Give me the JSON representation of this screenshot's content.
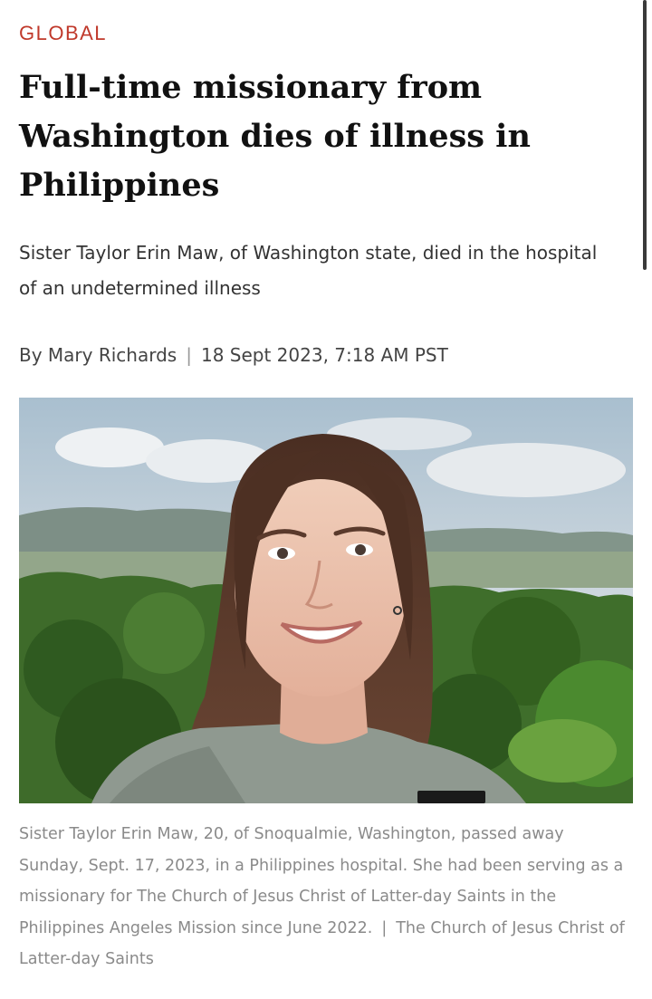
{
  "article": {
    "section": "GLOBAL",
    "headline": "Full-time missionary from Washington dies of illness in Philippines",
    "subheadline": "Sister Taylor Erin Maw, of Washington state, died in the hospital of an undetermined illness",
    "byline": {
      "author": "By Mary Richards",
      "separator": "|",
      "date": "18 Sept 2023, 7:18 AM PST"
    },
    "photo": {
      "caption": "Sister Taylor Erin Maw, 20, of Snoqualmie, Washington, passed away Sunday, Sept. 17, 2023, in a Philippines hospital. She had been serving as a missionary for The Church of Jesus Christ of Latter-day Saints in the Philippines Angeles Mission since June 2022.",
      "caption_separator": "|",
      "credit": "The Church of Jesus Christ of Latter-day Saints"
    }
  },
  "colors": {
    "section_accent": "#c0392b",
    "headline": "#111111",
    "caption": "#8a8a8a"
  }
}
